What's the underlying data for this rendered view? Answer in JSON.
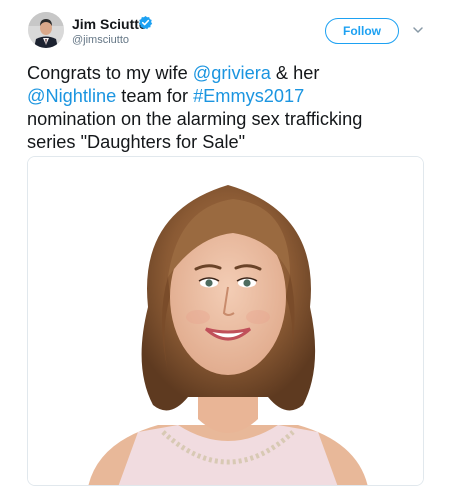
{
  "author": {
    "display_name": "Jim Sciutto",
    "handle": "@jimsciutto"
  },
  "follow_button": {
    "label": "Follow"
  },
  "tweet": {
    "line1_a": "Congrats to my wife ",
    "mention1": "@griviera",
    "line1_b": " & her",
    "mention2": "@Nightline",
    "line2_a": " team for ",
    "hashtag": "#Emmys2017",
    "line3": "nomination on the alarming sex trafficking",
    "line4": "series \"Daughters for Sale\""
  },
  "colors": {
    "link": "#1b95e0",
    "verified": "#1da1f2",
    "text": "#14171a",
    "muted": "#657786"
  },
  "icons": {
    "verified": "verified-badge-icon",
    "caret": "chevron-down-icon"
  }
}
